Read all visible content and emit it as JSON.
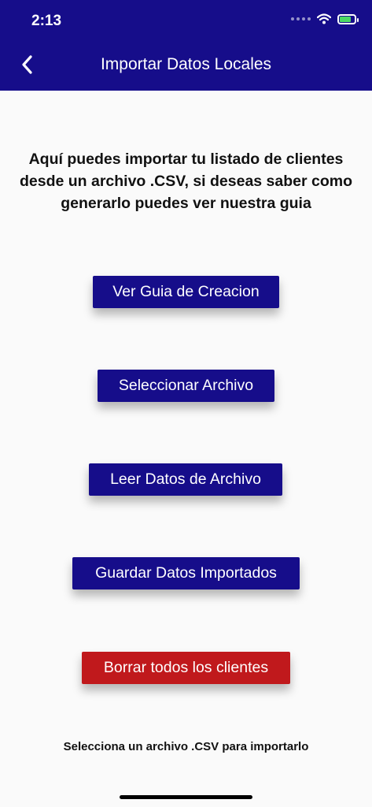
{
  "status_bar": {
    "time": "2:13"
  },
  "nav": {
    "title": "Importar Datos Locales",
    "back_icon": "chevron-left-icon"
  },
  "intro_text": "Aquí puedes importar tu listado de clientes desde un archivo .CSV, si deseas saber como generarlo puedes ver nuestra guia",
  "buttons": {
    "guide": "Ver Guia de Creacion",
    "select_file": "Seleccionar Archivo",
    "read_data": "Leer Datos de Archivo",
    "save_data": "Guardar Datos Importados",
    "delete_all": "Borrar todos los clientes"
  },
  "footer_message": "Selecciona un archivo .CSV para importarlo",
  "colors": {
    "primary": "#160d8a",
    "danger": "#c0191c",
    "background": "#fafafa",
    "battery": "#4cd964"
  }
}
